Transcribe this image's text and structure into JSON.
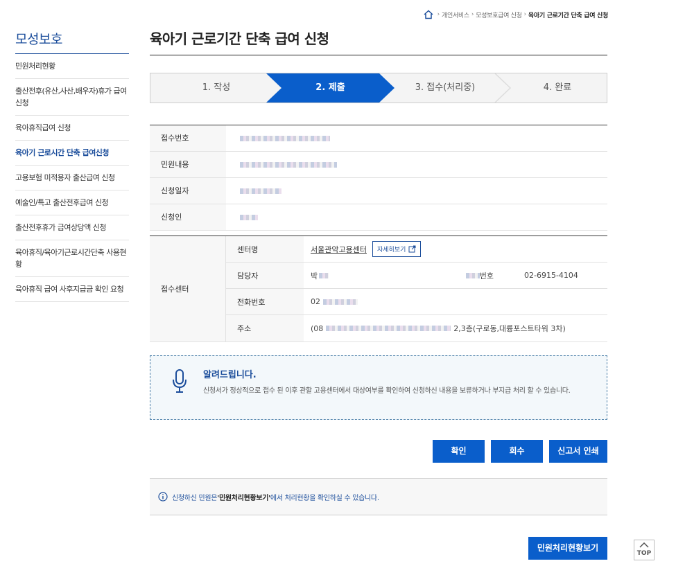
{
  "breadcrumb": {
    "items": [
      "개인서비스",
      "모성보호급여 신청"
    ],
    "current": "육아기 근로기간 단축 급여 신청"
  },
  "sidebar": {
    "title": "모성보호",
    "items": [
      {
        "label": "민원처리현황"
      },
      {
        "label": "출산전후(유산,사산,배우자)휴가 급여신청"
      },
      {
        "label": "육아휴직급여 신청"
      },
      {
        "label": "육아기 근로시간 단축 급여신청"
      },
      {
        "label": "고용보험 미적용자 출산급여 신청"
      },
      {
        "label": "예술인/특고 출산전후급여 신청"
      },
      {
        "label": "출산전후휴가 급여상당액 신청"
      },
      {
        "label": "육아휴직/육아기근로시간단축 사용현황"
      },
      {
        "label": "육아휴직 급여 사후지급금 확인 요청"
      }
    ]
  },
  "page": {
    "title": "육아기 근로기간 단축 급여 신청"
  },
  "steps": [
    "1. 작성",
    "2. 제출",
    "3. 접수(처리중)",
    "4. 완료"
  ],
  "receipt": {
    "rows": [
      {
        "label": "접수번호"
      },
      {
        "label": "민원내용"
      },
      {
        "label": "신청일자"
      },
      {
        "label": "신청인"
      }
    ]
  },
  "center": {
    "group_label": "접수센터",
    "name_label": "센터명",
    "name_value": "서울관악고용센터",
    "detail_button": "자세히보기",
    "manager_label": "담당자",
    "manager_value": "박",
    "manager_phone_label": "번호",
    "manager_phone": "02-6915-4104",
    "phone_label": "전화번호",
    "phone_value": "02",
    "address_label": "주소",
    "address_prefix": "(08",
    "address_suffix": "2,3층(구로동,대륭포스트타워 3차)"
  },
  "notice": {
    "title": "알려드립니다.",
    "text": "신청서가 정상적으로 접수 된 이후 관할 고용센터에서 대상여부를 확인하여 신청하신 내용을 보류하거나 부지급 처리 할 수 있습니다."
  },
  "actions": {
    "confirm": "확인",
    "withdraw": "회수",
    "print": "신고서 인쇄"
  },
  "bottom_info": {
    "prefix": "신청하신 민원은 ",
    "strong": "'민원처리현황보기'",
    "suffix": "에서 처리현황을 확인하실 수 있습니다."
  },
  "status_button": "민원처리현황보기",
  "top_button": "TOP",
  "colors": {
    "primary": "#0a5ecb",
    "brand": "#1b4d9b"
  }
}
